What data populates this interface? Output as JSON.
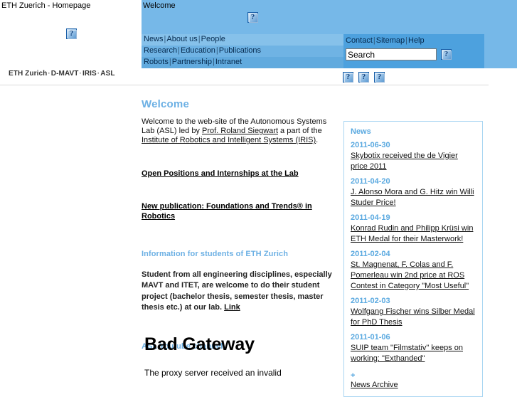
{
  "browser": {
    "site_title": "ETH Zuerich - Homepage",
    "page_title": "Welcome"
  },
  "header": {
    "logo_icon": "broken-image-icon",
    "banner_icon": "broken-image-icon",
    "accent_color": "#76b8e8",
    "panel_color": "#4da1de"
  },
  "nav": {
    "row1": [
      {
        "label": "News"
      },
      {
        "label": "About us"
      },
      {
        "label": "People"
      }
    ],
    "row2": [
      {
        "label": "Research"
      },
      {
        "label": "Education"
      },
      {
        "label": "Publications"
      }
    ],
    "row3": [
      {
        "label": "Robots"
      },
      {
        "label": "Partnership"
      },
      {
        "label": "Intranet"
      }
    ],
    "separator": "|"
  },
  "utility": {
    "links": [
      {
        "label": "Contact"
      },
      {
        "label": "Sitemap"
      },
      {
        "label": "Help"
      }
    ],
    "separator": "|",
    "search_value": "Search",
    "search_placeholder": "Search",
    "search_button_icon": "broken-image-icon"
  },
  "breadcrumb": {
    "items": [
      {
        "label": "ETH Zurich"
      },
      {
        "label": "D-MAVT"
      },
      {
        "label": "IRIS"
      },
      {
        "label": "ASL"
      }
    ],
    "separator": "·"
  },
  "icon_row": {
    "icons": [
      "broken-image-icon",
      "broken-image-icon",
      "broken-image-icon"
    ]
  },
  "main": {
    "welcome_heading": "Welcome",
    "welcome_intro_part1": "Welcome to the web-site of the Autonomous Systems Lab (ASL) led  by ",
    "welcome_link_person": "Prof. Roland Siegwart",
    "welcome_intro_part2": " a part of the ",
    "welcome_link_institute": "Institute of Robotics and Intelligent Systems (IRIS)",
    "welcome_intro_part3": ".",
    "promo_positions": "Open Positions and Internships at the Lab",
    "promo_publication": "New publication: Foundations and Trends® in Robotics",
    "students_heading": "Information for students of ETH Zurich",
    "students_text": "Student from all engineering disciplines, especially MAVT and ITET, are welcome to do their student project (bachelor thesis, semester thesis, master thesis etc.) at our lab. ",
    "students_link": "Link",
    "youtube_heading": "ASL Youtube channel"
  },
  "error": {
    "title": "Bad Gateway",
    "message": "The proxy server received an invalid"
  },
  "news": {
    "heading": "News",
    "items": [
      {
        "date": "2011-06-30",
        "title": "Skybotix received the de Vigier price 2011"
      },
      {
        "date": "2011-04-20",
        "title": "J. Alonso Mora and G. Hitz win Willi Studer Price!"
      },
      {
        "date": "2011-04-19",
        "title": "Konrad Rudin and Philipp Krüsi win ETH Medal for their Masterwork!"
      },
      {
        "date": "2011-02-04",
        "title": "St. Magnenat, F. Colas and F. Pomerleau win 2nd price at ROS Contest in Category \"Most Useful\""
      },
      {
        "date": "2011-02-03",
        "title": "Wolfgang Fischer wins Silber Medal for PhD Thesis"
      },
      {
        "date": "2011-01-06",
        "title": "SUIP team \"Filmstativ\" keeps on working: \"Exthanded\""
      }
    ],
    "plus": "+",
    "archive_label": "News Archive"
  }
}
